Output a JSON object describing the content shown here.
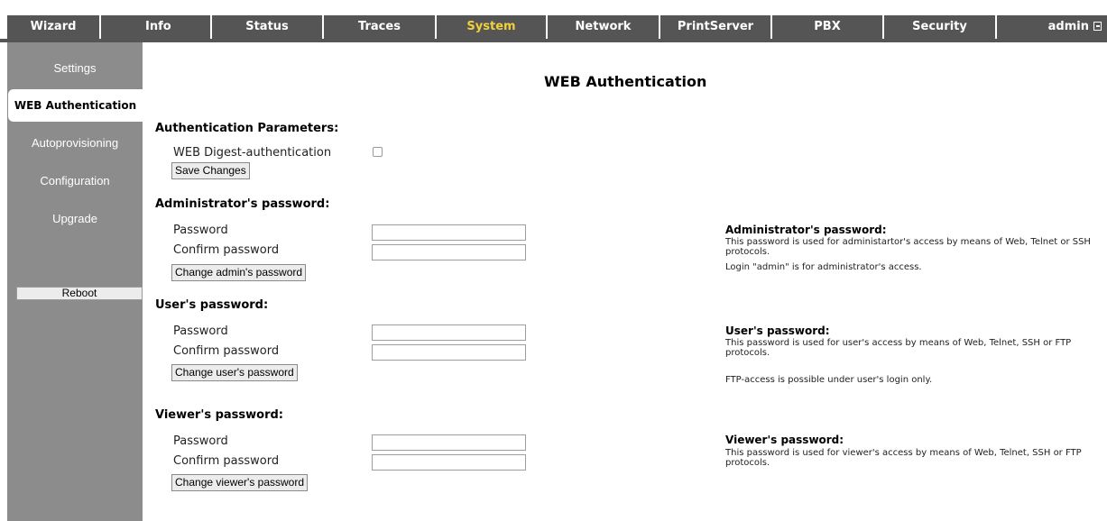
{
  "nav": {
    "tabs": [
      {
        "label": "Wizard",
        "active": false
      },
      {
        "label": "Info",
        "active": false
      },
      {
        "label": "Status",
        "active": false
      },
      {
        "label": "Traces",
        "active": false
      },
      {
        "label": "System",
        "active": true
      },
      {
        "label": "Network",
        "active": false
      },
      {
        "label": "PrintServer",
        "active": false
      },
      {
        "label": "PBX",
        "active": false
      },
      {
        "label": "Security",
        "active": false
      }
    ],
    "user_label": "admin",
    "colors": {
      "tab_bg": "#555555",
      "tab_text": "#ffffff",
      "active_text": "#f2d03c"
    }
  },
  "sidebar": {
    "items": [
      {
        "label": "Settings",
        "active": false
      },
      {
        "label": "WEB Authentication",
        "active": true
      },
      {
        "label": "Autoprovisioning",
        "active": false
      },
      {
        "label": "Configuration",
        "active": false
      },
      {
        "label": "Upgrade",
        "active": false
      }
    ],
    "reboot_label": "Reboot",
    "colors": {
      "bg": "#8c8c8c"
    }
  },
  "page": {
    "title": "WEB Authentication",
    "auth_params": {
      "heading": "Authentication Parameters:",
      "digest_label": "WEB Digest-authentication",
      "digest_checked": false,
      "save_button": "Save Changes"
    },
    "admin": {
      "heading": "Administrator's password:",
      "password_label": "Password",
      "confirm_label": "Confirm password",
      "password_value": "",
      "confirm_value": "",
      "button": "Change admin's password"
    },
    "user": {
      "heading": "User's password:",
      "password_label": "Password",
      "confirm_label": "Confirm password",
      "password_value": "",
      "confirm_value": "",
      "button": "Change user's password"
    },
    "viewer": {
      "heading": "Viewer's password:",
      "password_label": "Password",
      "confirm_label": "Confirm password",
      "password_value": "",
      "confirm_value": "",
      "button": "Change viewer's password"
    }
  },
  "help": {
    "admin": {
      "title": "Administrator's password:",
      "line1": "This password is used for administartor's access by means of Web, Telnet or SSH protocols.",
      "line2": "Login \"admin\" is for administrator's access."
    },
    "user": {
      "title": "User's password:",
      "line1": "This password is used for user's access by means of Web, Telnet, SSH or FTP protocols.",
      "line2": "FTP-access is possible under user's login only."
    },
    "viewer": {
      "title": "Viewer's password:",
      "line1": "This password is used for viewer's access by means of Web, Telnet, SSH or FTP protocols."
    }
  }
}
